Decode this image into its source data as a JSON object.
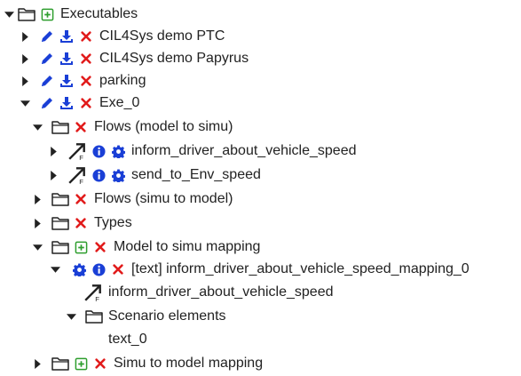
{
  "colors": {
    "edit": "#1a3fd6",
    "download": "#1a3fd6",
    "delete": "#e11b1b",
    "info": "#1a3fd6",
    "settings": "#1a3fd6",
    "add": "#2e9e2e",
    "text": "#222222"
  },
  "tree": {
    "executables": "Executables",
    "exe_items": [
      "CIL4Sys demo PTC",
      "CIL4Sys demo Papyrus",
      "parking",
      "Exe_0"
    ],
    "flows_model_to_simu": "Flows (model to simu)",
    "flow_items": [
      "inform_driver_about_vehicle_speed",
      "send_to_Env_speed"
    ],
    "flows_simu_to_model": "Flows (simu to model)",
    "types": "Types",
    "model_to_simu_mapping": "Model to simu mapping",
    "mapping_item": "[text] inform_driver_about_vehicle_speed_mapping_0",
    "mapping_flow": "inform_driver_about_vehicle_speed",
    "scenario_elements": "Scenario elements",
    "scenario_item": "text_0",
    "simu_to_model_mapping": "Simu to model mapping"
  }
}
